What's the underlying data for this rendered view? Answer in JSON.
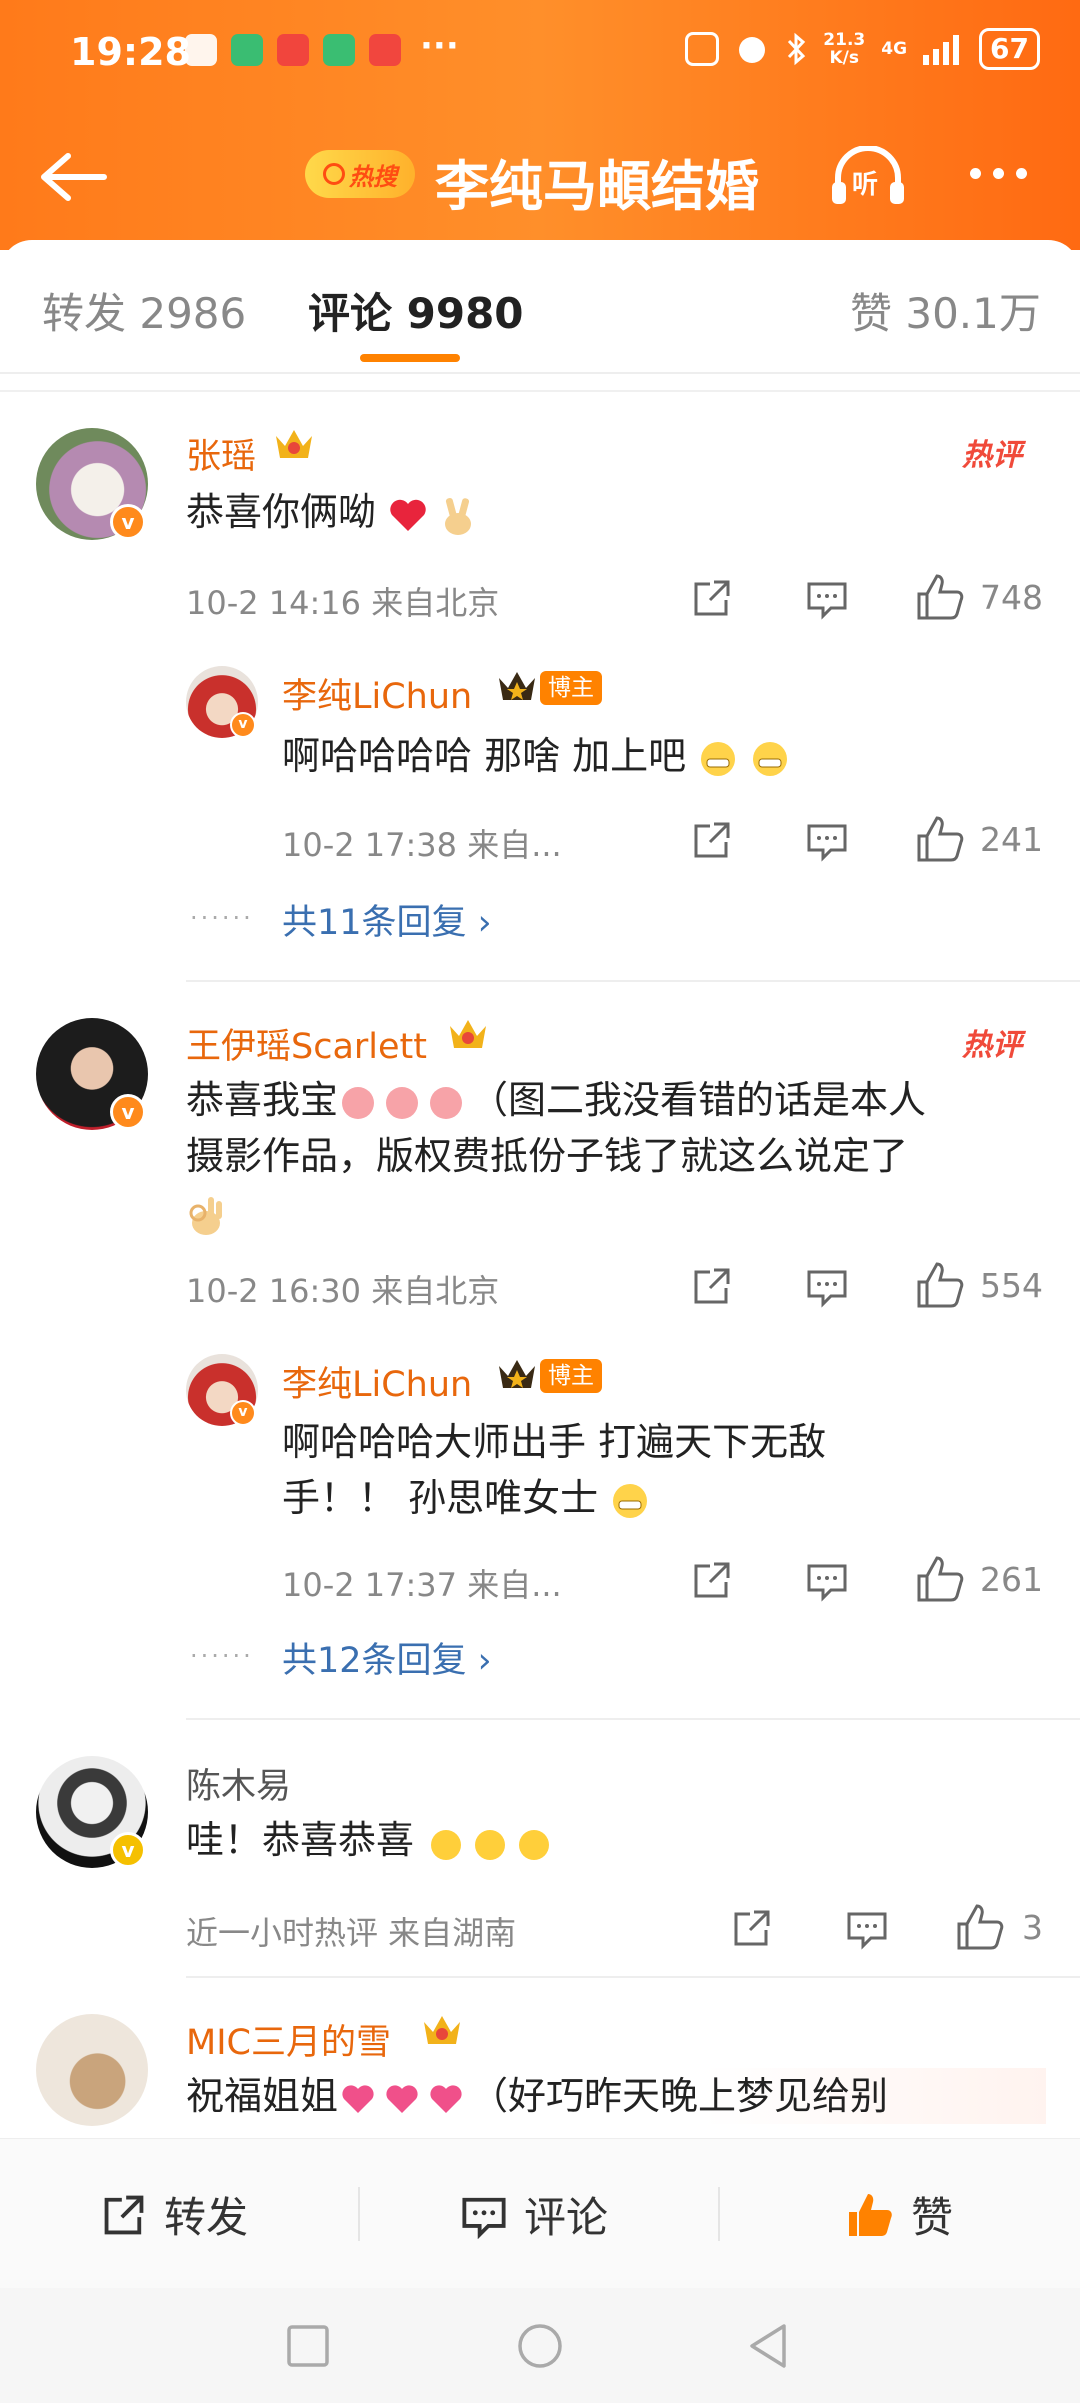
{
  "status_bar": {
    "time": "19:28",
    "network_speed": "21.3\nK/s",
    "network_type": "4G",
    "battery": "67"
  },
  "nav": {
    "hot_badge": "热搜",
    "title": "李纯马頔结婚",
    "listen_label": "听"
  },
  "tabs": {
    "repost": "转发 2986",
    "comment": "评论 9980",
    "like": "赞 30.1万"
  },
  "comments": [
    {
      "user": "张瑶",
      "text": "恭喜你俩呦",
      "hot_tag": "热评",
      "meta": "10-2 14:16  来自北京",
      "likes": "748",
      "reply": {
        "user": "李纯LiChun",
        "badge": "博主",
        "text": "啊哈哈哈哈 那啥  加上吧",
        "meta": "10-2 17:38  来自...",
        "likes": "241"
      },
      "more_replies": "共11条回复 ›"
    },
    {
      "user": "王伊瑶Scarlett",
      "text_line1": "恭喜我宝",
      "text_line1b": "（图二我没看错的话是本人",
      "text_line2": "摄影作品，版权费抵份子钱了就这么说定了",
      "hot_tag": "热评",
      "meta": "10-2 16:30  来自北京",
      "likes": "554",
      "reply": {
        "user": "李纯LiChun",
        "badge": "博主",
        "text_line1": "啊哈哈哈大师出手 打遍天下无敌",
        "text_line2": "手！！ 孙思唯女士",
        "meta": "10-2 17:37  来自...",
        "likes": "261"
      },
      "more_replies": "共12条回复 ›"
    },
    {
      "user": "陈木易",
      "text": "哇！恭喜恭喜",
      "meta": "近一小时热评  来自湖南",
      "likes": "3"
    },
    {
      "user": "MIC三月的雪",
      "text": "祝福姐姐",
      "text_b": "（好巧昨天晚上梦见给别"
    }
  ],
  "bottom_bar": {
    "repost": "转发",
    "comment": "评论",
    "like": "赞"
  },
  "colors": {
    "accent": "#ff8200",
    "username": "#e8670c",
    "link": "#3a6fb0"
  }
}
